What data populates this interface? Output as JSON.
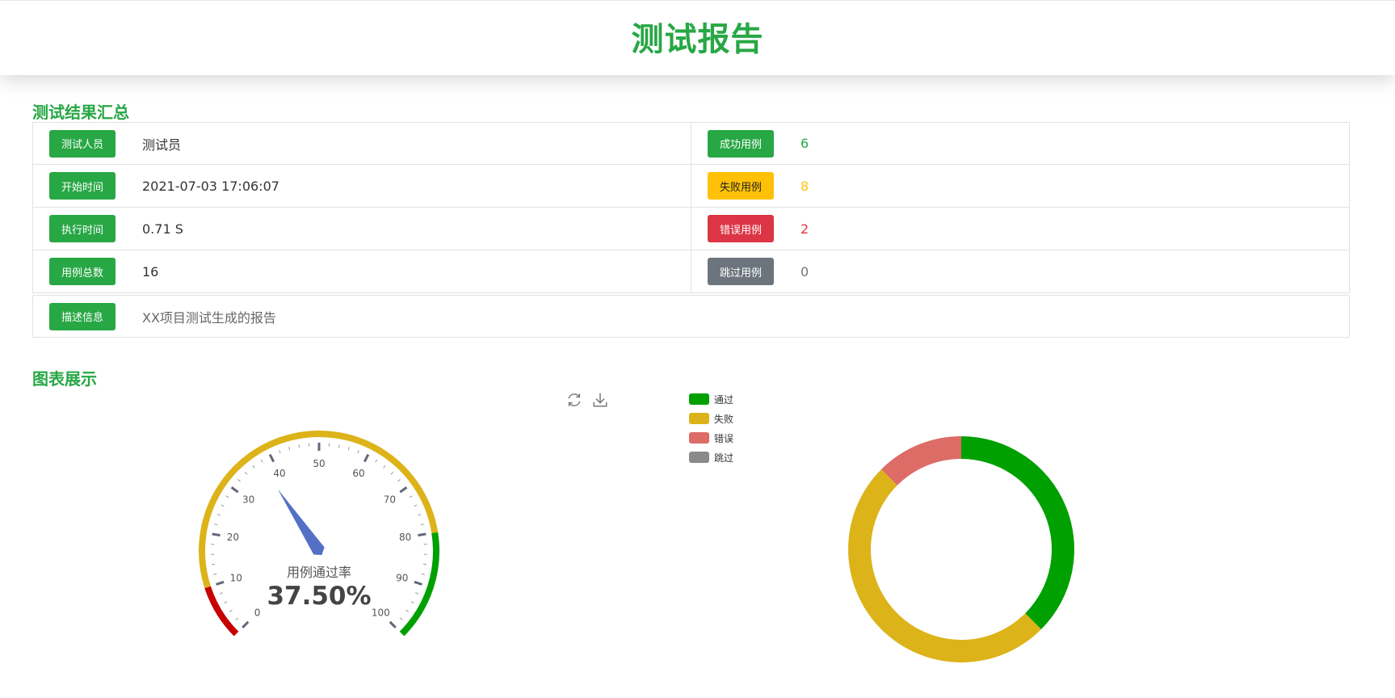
{
  "header": {
    "title": "测试报告"
  },
  "summary": {
    "section_title": "测试结果汇总",
    "left": [
      {
        "label": "测试人员",
        "value": "测试员"
      },
      {
        "label": "开始时间",
        "value": "2021-07-03 17:06:07"
      },
      {
        "label": "执行时间",
        "value": "0.71 S"
      },
      {
        "label": "用例总数",
        "value": "16"
      }
    ],
    "right": [
      {
        "label": "成功用例",
        "value": "6"
      },
      {
        "label": "失败用例",
        "value": "8"
      },
      {
        "label": "错误用例",
        "value": "2"
      },
      {
        "label": "跳过用例",
        "value": "0"
      }
    ],
    "description": {
      "label": "描述信息",
      "value": "XX项目测试生成的报告"
    }
  },
  "charts_section": {
    "title": "图表展示"
  },
  "colors": {
    "primary": "#28a745",
    "warning": "#ffc107",
    "danger": "#dc3545",
    "secondary": "#6c757d",
    "pass": "#00a000",
    "fail": "#dcb319",
    "error": "#dd6b66",
    "skip": "#8a8a8a",
    "gauge_low": "#c70000",
    "needle": "#5470c6"
  },
  "icons": {
    "refresh": "refresh-icon",
    "download": "download-icon"
  },
  "chart_data": [
    {
      "type": "gauge",
      "title": "用例通过率",
      "value": 37.5,
      "display_value": "37.50%",
      "min": 0,
      "max": 100,
      "tick_labels": [
        "0",
        "10",
        "20",
        "30",
        "40",
        "50",
        "60",
        "70",
        "80",
        "90",
        "100"
      ],
      "bands": [
        {
          "to": 10,
          "color": "#c70000"
        },
        {
          "to": 80,
          "color": "#dcb319"
        },
        {
          "to": 100,
          "color": "#00a000"
        }
      ]
    },
    {
      "type": "pie",
      "donut": true,
      "legend_position": "top-left",
      "series": [
        {
          "name": "通过",
          "value": 6,
          "color": "#00a000"
        },
        {
          "name": "失败",
          "value": 8,
          "color": "#dcb319"
        },
        {
          "name": "错误",
          "value": 2,
          "color": "#dd6b66"
        },
        {
          "name": "跳过",
          "value": 0,
          "color": "#8a8a8a"
        }
      ]
    }
  ]
}
